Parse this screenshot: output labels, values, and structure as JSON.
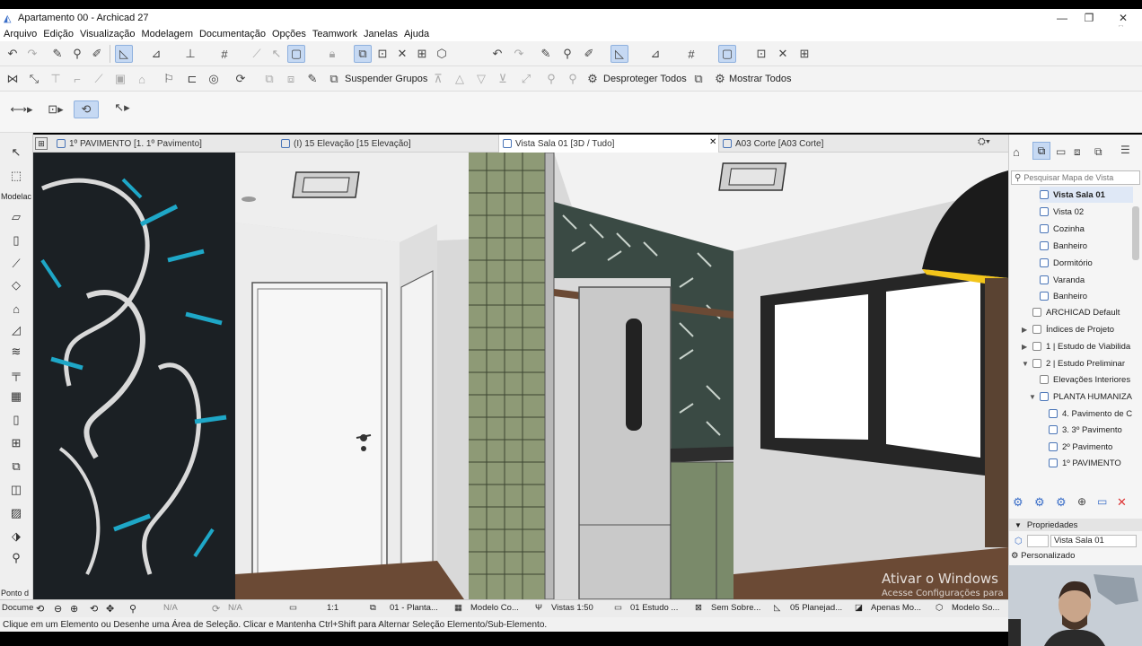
{
  "window": {
    "title": "Apartamento 00 - Archicad 27",
    "minimize": "—",
    "maximize": "❐",
    "close": "✕"
  },
  "menu": [
    "Arquivo",
    "Edição",
    "Visualização",
    "Modelagem",
    "Documentação",
    "Opções",
    "Teamwork",
    "Janelas",
    "Ajuda"
  ],
  "toolbar": {
    "suspend_groups": "Suspender Grupos",
    "unprotect_all": "Desproteger Todos",
    "show_all": "Mostrar Todos"
  },
  "toolbox": {
    "model_caption": "Modelac",
    "point_caption": "Ponto d"
  },
  "tabs": [
    {
      "label": "1º PAVIMENTO [1.  1º Pavimento]"
    },
    {
      "label": "(I) 15 Elevação [15 Elevação]"
    },
    {
      "label": "Vista Sala 01 [3D / Tudo]",
      "close": "✕"
    },
    {
      "label": "A03 Corte [A03 Corte]"
    }
  ],
  "navigator": {
    "search_placeholder": "Pesquisar Mapa de Vista",
    "items": [
      {
        "label": "Vista Sala 01"
      },
      {
        "label": "Vista 02"
      },
      {
        "label": "Cozinha"
      },
      {
        "label": "Banheiro"
      },
      {
        "label": "Dormitório"
      },
      {
        "label": "Varanda"
      },
      {
        "label": "Banheiro"
      },
      {
        "label": "ARCHICAD Default"
      },
      {
        "label": "Índices de Projeto"
      },
      {
        "label": "1 | Estudo de Viabilida"
      },
      {
        "label": "2 | Estudo Preliminar"
      },
      {
        "label": "Elevações Interiores"
      },
      {
        "label": "PLANTA HUMANIZA"
      },
      {
        "label": "4. Pavimento de C"
      },
      {
        "label": "3. 3º Pavimento"
      },
      {
        "label": "2º Pavimento"
      },
      {
        "label": "1º PAVIMENTO"
      }
    ],
    "properties_header": "Propriedades",
    "properties_name": "Vista Sala 01",
    "properties_custom": "Personalizado"
  },
  "statusbar": {
    "na1": "N/A",
    "na2": "N/A",
    "scale": "1:1",
    "layer1": "01 - Planta...",
    "model": "Modelo Co...",
    "views": "Vistas 1:50",
    "study": "01 Estudo ...",
    "override": "Sem Sobre...",
    "planned": "05 Planejad...",
    "only": "Apenas Mo...",
    "model2": "Modelo So..."
  },
  "hint": "Clique em um Elemento ou Desenhe uma Área de Seleção. Clicar e Mantenha Ctrl+Shift para Alternar Seleção Elemento/Sub-Elemento.",
  "statusbar_left": "Docume",
  "watermark": {
    "line1": "Ativar o Windows",
    "line2": "Acesse Configurações para"
  },
  "colors": {
    "accent": "#3a6ec8",
    "selected": "#c6d9f3",
    "blackboard": "#1b2024",
    "cyan": "#1ea7c7",
    "greenwall": "#8e9a76",
    "yellow": "#f3c51a"
  }
}
